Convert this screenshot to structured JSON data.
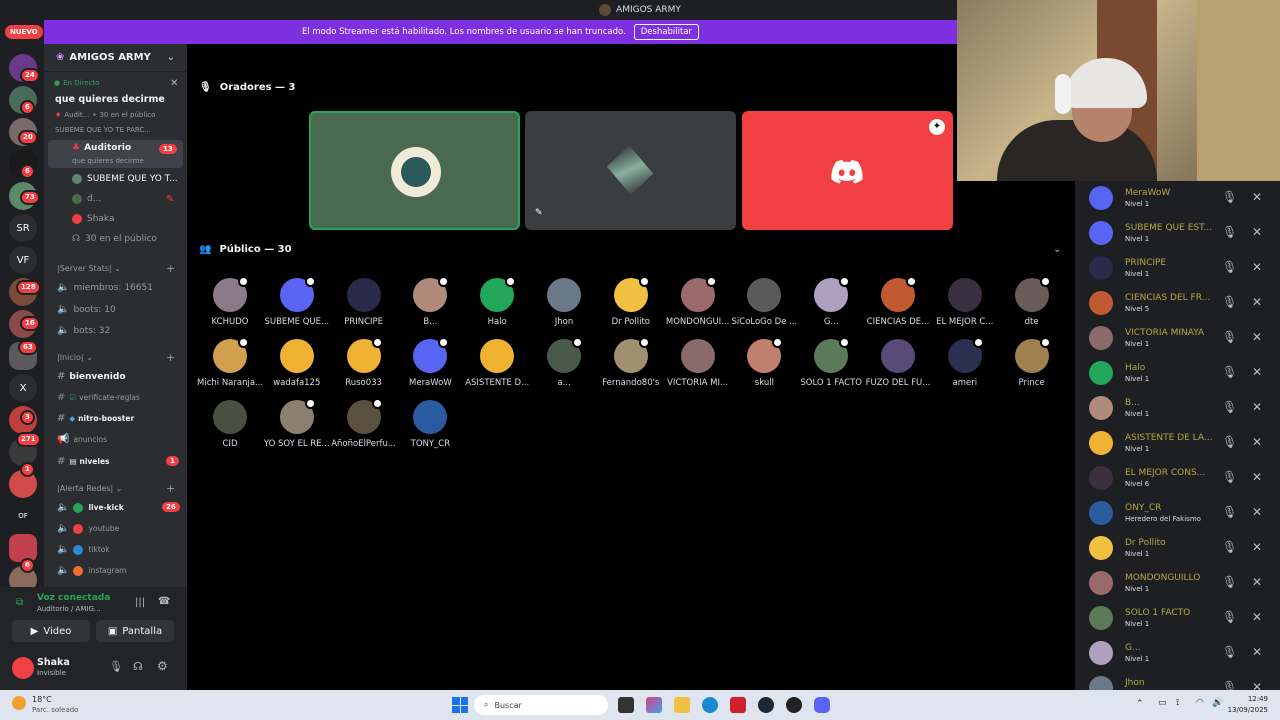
{
  "window_title": "AMIGOS ARMY",
  "banner": {
    "text": "El modo Streamer está habilitado. Los nombres de usuario se han truncado.",
    "button": "Deshabilitar",
    "color": "#7e2fe0"
  },
  "rail": {
    "new_label": "NUEVO",
    "badges": [
      "24",
      "6",
      "20",
      "6",
      "73",
      "128",
      "16",
      "63",
      "3",
      "271",
      "1",
      "6"
    ],
    "texts": [
      "SR",
      "VF",
      "X",
      "OF"
    ]
  },
  "server": {
    "name": "AMIGOS ARMY",
    "live_label": "En Directo",
    "live_title": "que quieres decirme",
    "live_sub": "Audit...",
    "live_count": "30 en el público",
    "live_sub2": "SUBEME QUE YO TE PARC...",
    "stage_channel": "Auditorio",
    "stage_badge": "13",
    "stage_topic": "que quieres decirme",
    "stage_members": [
      "SUBEME QUE YO T...",
      "d...",
      "Shaka"
    ],
    "stage_public": "30 en el público",
    "categories": [
      "Server Stats",
      "Inicio",
      "Alerta Redes"
    ],
    "stats": [
      "miembros: 16651",
      "boots: 10",
      "bots: 32"
    ],
    "inicio_channels": [
      "bienvenido",
      "verificate-reglas",
      "nitro-booster",
      "anuncios",
      "niveles"
    ],
    "niveles_badge": "1",
    "redes_channels": [
      "live-kick",
      "youtube",
      "tiktok",
      "instagram"
    ],
    "live_kick_badge": "26"
  },
  "voice": {
    "status": "Voz conectada",
    "channel": "Auditorio / AMIG...",
    "video_label": "Video",
    "screen_label": "Pantalla"
  },
  "user": {
    "name": "Shaka",
    "status": "Invisible"
  },
  "stage": {
    "speakers_header": "Oradores — 3",
    "audience_header": "Público — 30"
  },
  "audience": [
    {
      "name": "KCHUDO",
      "color": "#8a7a8a"
    },
    {
      "name": "SUBEME QUE...",
      "color": "#5865f2"
    },
    {
      "name": "PRINCIPE",
      "color": "#2a2a4a"
    },
    {
      "name": "B...",
      "color": "#b08a7a"
    },
    {
      "name": "Halo",
      "color": "#23a55a"
    },
    {
      "name": "Jhon",
      "color": "#6a7a8a"
    },
    {
      "name": "Dr Pollito",
      "color": "#f0c040"
    },
    {
      "name": "MONDONGUI...",
      "color": "#9a6a6a"
    },
    {
      "name": "SiCoLoGo De ...",
      "color": "#5a5a5a"
    },
    {
      "name": "G...",
      "color": "#b0a0c0"
    },
    {
      "name": "CIENCIAS DE...",
      "color": "#c05a30"
    },
    {
      "name": "EL MEJOR C...",
      "color": "#3a3040"
    },
    {
      "name": "dte",
      "color": "#6a5a5a"
    },
    {
      "name": "Michi Naranja...",
      "color": "#d0a050"
    },
    {
      "name": "wadafa125",
      "color": "#f0b232"
    },
    {
      "name": "Ruso033",
      "color": "#f0b232"
    },
    {
      "name": "MeraWoW",
      "color": "#5865f2"
    },
    {
      "name": "ASISTENTE D...",
      "color": "#f0b232"
    },
    {
      "name": "a...",
      "color": "#4a5a4a"
    },
    {
      "name": "Fernando80's",
      "color": "#a09070"
    },
    {
      "name": "VICTORIA MI...",
      "color": "#8a6a6a"
    },
    {
      "name": "skull",
      "color": "#c08070"
    },
    {
      "name": "SOLO 1 FACTO",
      "color": "#5a7a5a"
    },
    {
      "name": "FUZO DEL FU...",
      "color": "#5a4a7a"
    },
    {
      "name": "ameri",
      "color": "#2a3050"
    },
    {
      "name": "Prince",
      "color": "#a08050"
    },
    {
      "name": "CID",
      "color": "#4a5040"
    },
    {
      "name": "YO SOY EL RE...",
      "color": "#8a8070"
    },
    {
      "name": "AñoñoElPerfu...",
      "color": "#5a5040"
    },
    {
      "name": "TONY_CR",
      "color": "#2a5aa0"
    }
  ],
  "speakers_list": [
    {
      "name": "MeraWoW",
      "level": "Nivel 1",
      "color": "#5865f2"
    },
    {
      "name": "SUBEME QUE EST...",
      "level": "Nivel 1",
      "color": "#5865f2"
    },
    {
      "name": "PRINCIPE",
      "level": "Nivel 1",
      "color": "#2a2a4a"
    },
    {
      "name": "CIENCIAS DEL FR...",
      "level": "Nivel 5",
      "color": "#c05a30"
    },
    {
      "name": "VICTORIA MINAYA",
      "level": "Nivel 1",
      "color": "#8a6a6a"
    },
    {
      "name": "Halo",
      "level": "Nivel 1",
      "color": "#23a55a"
    },
    {
      "name": "B...",
      "level": "Nivel 1",
      "color": "#b08a7a"
    },
    {
      "name": "ASISTENTE DE LA...",
      "level": "Nivel 1",
      "color": "#f0b232"
    },
    {
      "name": "EL MEJOR CONS...",
      "level": "Nivel 6",
      "color": "#3a3040"
    },
    {
      "name": "ONY_CR",
      "level": "Heredero del Fakismo",
      "color": "#2a5aa0"
    },
    {
      "name": "Dr Pollito",
      "level": "Nivel 1",
      "color": "#f0c040"
    },
    {
      "name": "MONDONGUILLO",
      "level": "Nivel 1",
      "color": "#9a6a6a"
    },
    {
      "name": "SOLO 1 FACTO",
      "level": "Nivel 1",
      "color": "#5a7a5a"
    },
    {
      "name": "G...",
      "level": "Nivel 1",
      "color": "#b0a0c0"
    },
    {
      "name": "Jhon",
      "level": "",
      "color": "#6a7a8a"
    }
  ],
  "taskbar": {
    "weather_temp": "18°C",
    "weather_desc": "Parc. soleado",
    "search": "Buscar",
    "time": "12:49",
    "date": "13/09/2025"
  }
}
